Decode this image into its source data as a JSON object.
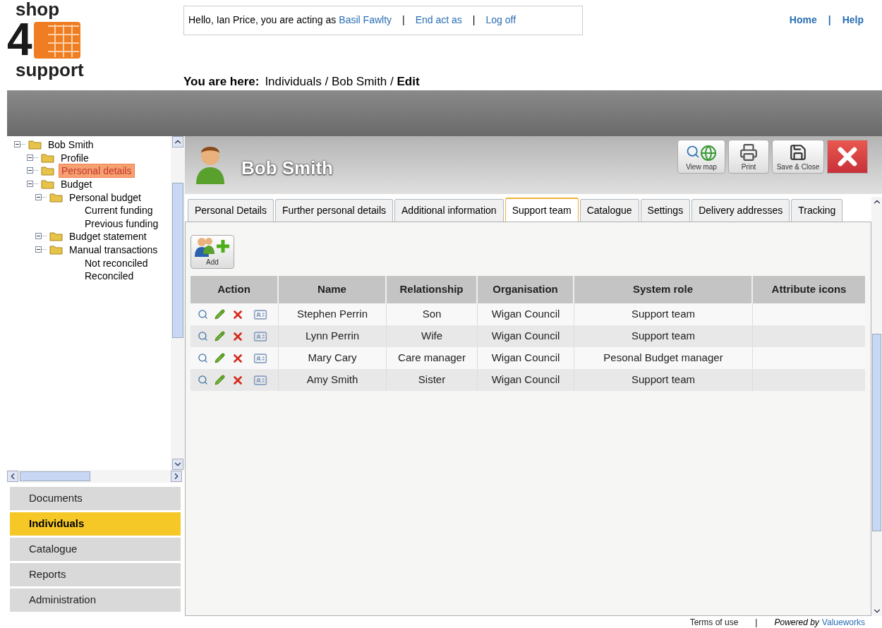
{
  "header": {
    "logo": {
      "top": "shop",
      "digit": "4",
      "bottom": "support"
    },
    "greeting": {
      "text": "Hello, Ian Price, you are acting as",
      "user": "Basil Fawlty",
      "links": [
        "End act as",
        "Log off"
      ],
      "separator": "|"
    },
    "top_links": {
      "items": [
        "Home",
        "Help"
      ],
      "separator": "|"
    },
    "breadcrumb": {
      "label": "You are here:",
      "path": "Individuals / Bob Smith / ",
      "current": "Edit"
    }
  },
  "tree": [
    {
      "label": "Bob Smith",
      "kind": "folder",
      "selected": false,
      "children": [
        {
          "label": "Profile",
          "kind": "folder",
          "selected": false
        },
        {
          "label": "Personal details",
          "kind": "folder",
          "selected": true
        },
        {
          "label": "Budget",
          "kind": "folder",
          "selected": false,
          "children": [
            {
              "label": "Personal budget",
              "kind": "folder",
              "selected": false,
              "children": [
                {
                  "label": "Current funding",
                  "kind": "page",
                  "selected": false
                },
                {
                  "label": "Previous funding",
                  "kind": "page",
                  "selected": false
                }
              ]
            },
            {
              "label": "Budget statement",
              "kind": "folder",
              "selected": false
            },
            {
              "label": "Manual transactions",
              "kind": "folder",
              "selected": false,
              "children": [
                {
                  "label": "Not reconciled",
                  "kind": "page",
                  "selected": false
                },
                {
                  "label": "Reconciled",
                  "kind": "page",
                  "selected": false
                }
              ]
            }
          ]
        }
      ]
    }
  ],
  "nav": [
    {
      "label": "Documents",
      "selected": false
    },
    {
      "label": "Individuals",
      "selected": true
    },
    {
      "label": "Catalogue",
      "selected": false
    },
    {
      "label": "Reports",
      "selected": false
    },
    {
      "label": "Administration",
      "selected": false
    }
  ],
  "person": {
    "name": "Bob Smith"
  },
  "toolbar": [
    {
      "kind": "view_map",
      "label": "View map"
    },
    {
      "kind": "print",
      "label": "Print"
    },
    {
      "kind": "save",
      "label": "Save & Close"
    },
    {
      "kind": "close"
    }
  ],
  "tabs": [
    {
      "label": "Personal Details",
      "selected": false
    },
    {
      "label": "Further personal details",
      "selected": false
    },
    {
      "label": "Additional information",
      "selected": false
    },
    {
      "label": "Support team",
      "selected": true
    },
    {
      "label": "Catalogue",
      "selected": false
    },
    {
      "label": "Settings",
      "selected": false
    },
    {
      "label": "Delivery addresses",
      "selected": false
    },
    {
      "label": "Tracking",
      "selected": false
    }
  ],
  "add_button": {
    "label": "Add"
  },
  "table": {
    "columns": [
      "Action",
      "Name",
      "Relationship",
      "Organisation",
      "System role",
      "Attribute icons"
    ],
    "rows": [
      {
        "name": "Stephen Perrin",
        "relationship": "Son",
        "organisation": "Wigan Council",
        "system_role": "Support team"
      },
      {
        "name": "Lynn Perrin",
        "relationship": "Wife",
        "organisation": "Wigan Council",
        "system_role": "Support team"
      },
      {
        "name": "Mary Cary",
        "relationship": "Care manager",
        "organisation": "Wigan Council",
        "system_role": "Pesonal Budget manager"
      },
      {
        "name": "Amy Smith",
        "relationship": "Sister",
        "organisation": "Wigan Council",
        "system_role": "Support team"
      }
    ]
  },
  "footer": {
    "terms": "Terms of use",
    "separator": "|",
    "powered": "Powered by",
    "brand": "Valueworks"
  }
}
